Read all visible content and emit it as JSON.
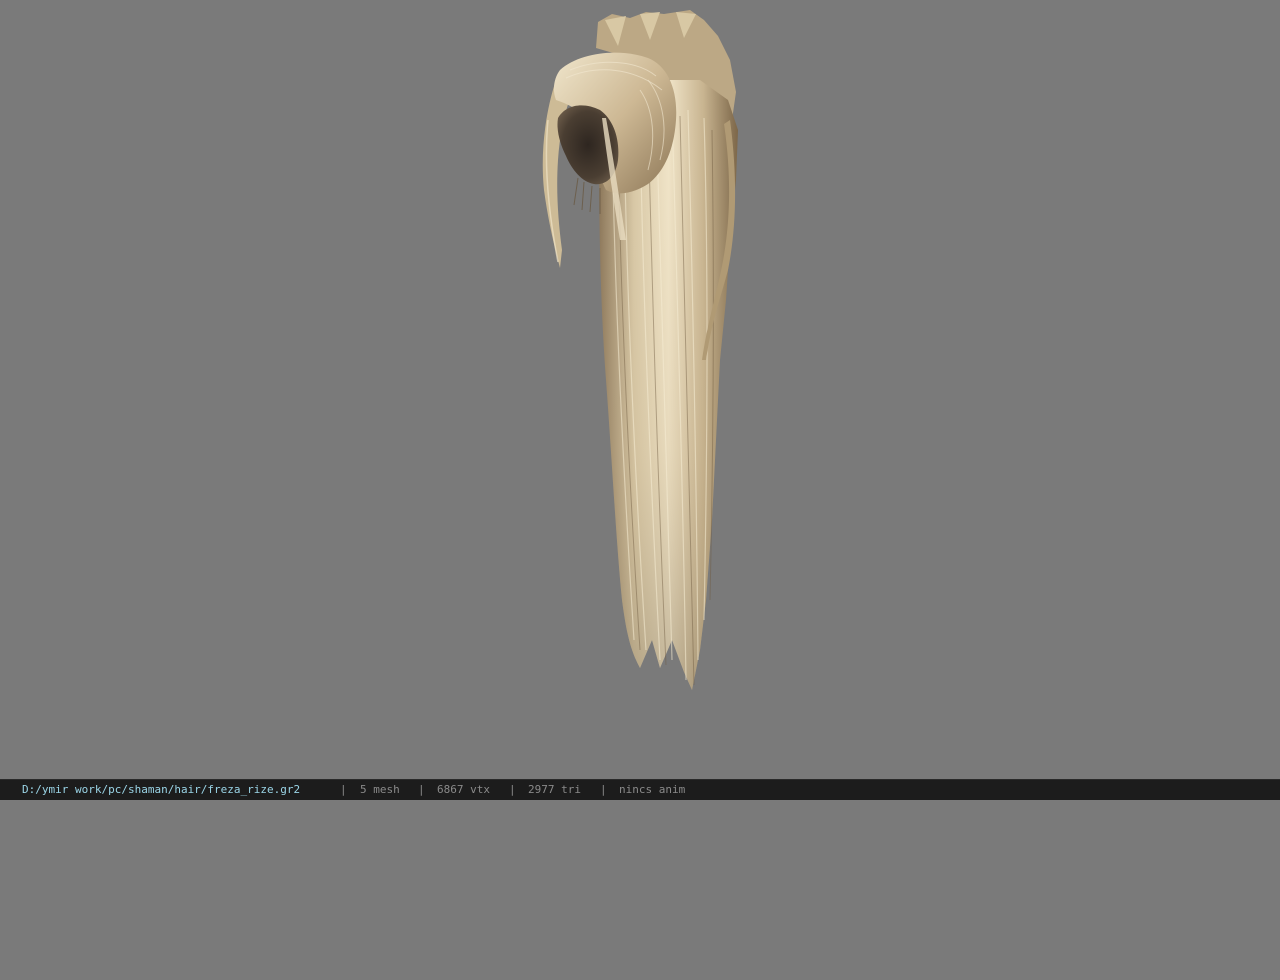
{
  "window": {
    "background_color": "#7a7a7a"
  },
  "viewport": {
    "model_name": "hair-model"
  },
  "statusbar": {
    "background_color": "#1c1c1c",
    "path_color": "#9ad4e6",
    "file_path": "D:/ymir work/pc/shaman/hair/freza_rize.gr2",
    "separator": "|",
    "mesh_count": "5 mesh",
    "vertex_count": "6867 vtx",
    "triangle_count": "2977 tri",
    "anim_status": "nincs anim"
  }
}
